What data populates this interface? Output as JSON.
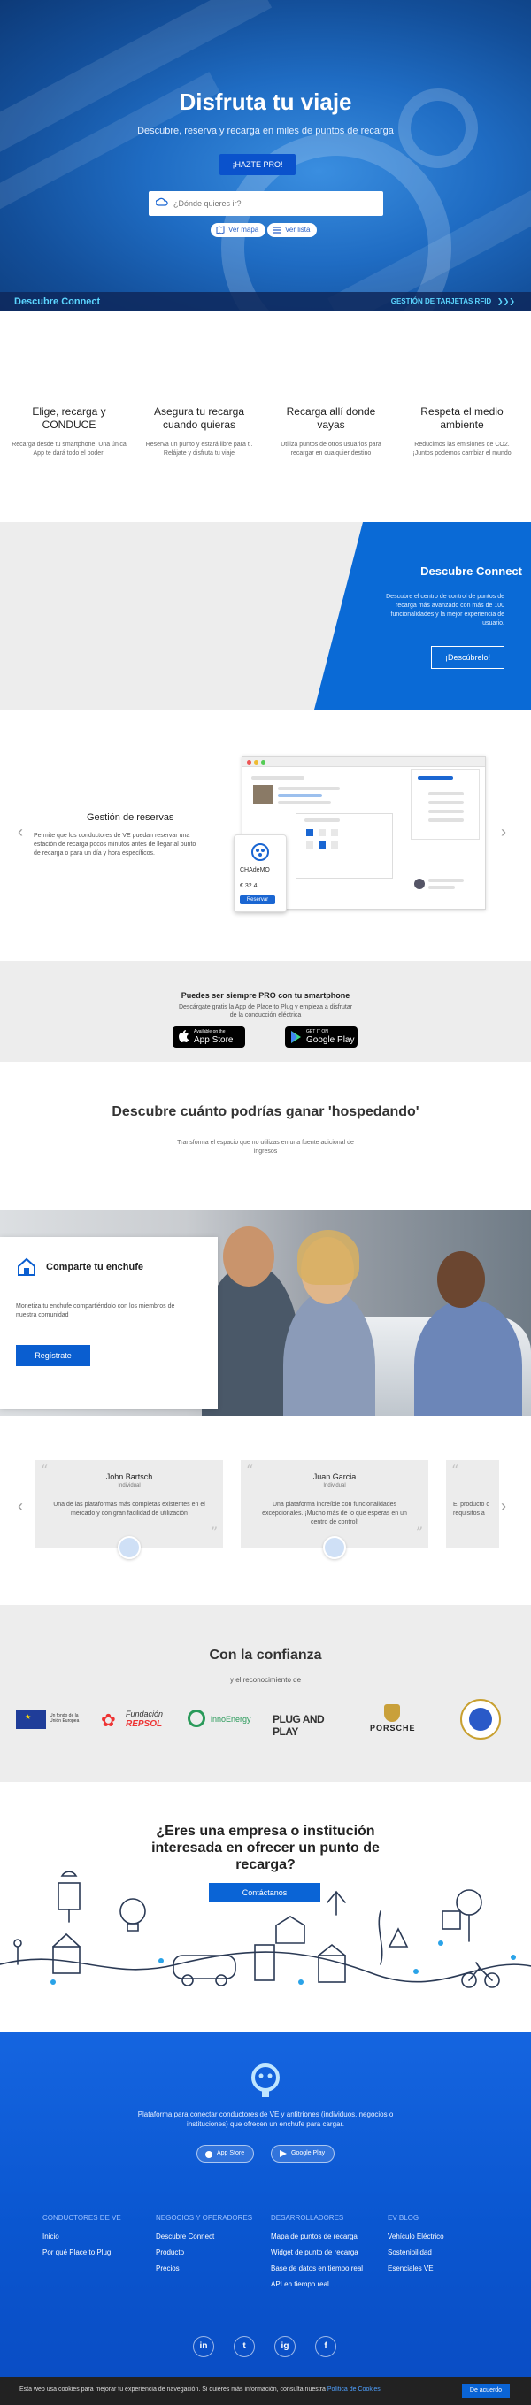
{
  "hero": {
    "title": "Disfruta tu viaje",
    "subtitle": "Descubre, reserva y recarga en miles de puntos de recarga",
    "pro_button": "¡HAZTE PRO!",
    "search_placeholder": "¿Dónde quieres ir?",
    "chip_map": "Ver mapa",
    "chip_list": "Ver lista",
    "bar_left": "Descubre Connect",
    "bar_right": "GESTIÓN DE TARJETAS RFID",
    "bar_arrows": "❯❯❯"
  },
  "features": [
    {
      "title": "Elige, recarga y CONDUCE",
      "text": "Recarga desde tu smartphone. Una única App te dará todo el poder!"
    },
    {
      "title": "Asegura tu recarga cuando quieras",
      "text": "Reserva un punto y estará libre para ti. Relájate y disfruta tu viaje"
    },
    {
      "title": "Recarga allí donde vayas",
      "text": "Utiliza puntos de otros usuarios para recargar en cualquier destino"
    },
    {
      "title": "Respeta el medio ambiente",
      "text": "Reducimos las emisiones de CO2. ¡Juntos podemos cambiar el mundo"
    }
  ],
  "connect": {
    "title": "Descubre Connect",
    "text": "Descubre el centro de control de puntos de recarga más avanzado con más de 100 funcionalidades y la mejor experiencia de usuario.",
    "button": "¡Descúbrelo!"
  },
  "reservas": {
    "title": "Gestión de reservas",
    "text": "Permite que los conductores de VE puedan reservar una estación de recarga pocos minutos antes de llegar al punto de recarga o para un día y hora específicos.",
    "phone_title": "CHAdeMO",
    "phone_price": "€ 32.4",
    "phone_button": "Reservar"
  },
  "apps": {
    "title": "Puedes ser siempre PRO con tu smartphone",
    "text": "Descárgate gratis la App de Place to Plug y empieza a disfrutar de la conducción eléctrica",
    "appstore_small": "Available on the",
    "appstore_big": "App Store",
    "google_small": "GET IT ON",
    "google_big": "Google Play"
  },
  "host": {
    "title": "Descubre cuánto podrías ganar 'hospedando'",
    "subtitle": "Transforma el espacio que no utilizas en una fuente adicional de ingresos"
  },
  "share": {
    "title": "Comparte tu enchufe",
    "text": "Monetiza tu enchufe compartiéndolo con los miembros de nuestra comunidad",
    "button": "Regístrate"
  },
  "testimonials": [
    {
      "name": "John Bartsch",
      "role": "Individual",
      "text": "Una de las plataformas más completas existentes en el mercado y con gran facilidad de utilización"
    },
    {
      "name": "Juan Garcia",
      "role": "Individual",
      "text": "Una plataforma increíble con funcionalidades excepcionales. ¡Mucho más de lo que esperas en un centro de control!"
    },
    {
      "name": "",
      "role": "",
      "text": "El producto c requisitos a"
    }
  ],
  "trust": {
    "title": "Con la confianza",
    "subtitle": "y el reconocimiento de",
    "logos": [
      "Unión Europea",
      "Fundación REPSOL",
      "Innoenergy",
      "PLUGANDPLAY",
      "PORSCHE",
      "Seal"
    ],
    "logo_texts": {
      "eu": "Un fondo de la Unión Europea",
      "repsol_1": "Fundación",
      "repsol_2": "REPSOL",
      "innoenergy": "innoEnergy",
      "plug": "PLUG AND PLAY",
      "porsche": "PORSCHE"
    }
  },
  "business": {
    "title": "¿Eres una empresa o institución interesada en ofrecer un punto de recarga?",
    "button": "Contáctanos"
  },
  "footer": {
    "tagline": "Plataforma para conectar conductores de VE y anfitriones (individuos, negocios o instituciones) que ofrecen un enchufe para cargar.",
    "appstore": "App Store",
    "googleplay": "Google Play",
    "columns": [
      {
        "heading": "CONDUCTORES DE VE",
        "items": [
          "Inicio",
          "Por qué Place to Plug"
        ]
      },
      {
        "heading": "NEGOCIOS Y OPERADORES",
        "items": [
          "Descubre Connect",
          "Producto",
          "Precios"
        ]
      },
      {
        "heading": "DESARROLLADORES",
        "items": [
          "Mapa de puntos de recarga",
          "Widget de punto de recarga",
          "Base de datos en tiempo real",
          "API en tiempo real"
        ]
      },
      {
        "heading": "EV BLOG",
        "items": [
          "Vehículo Eléctrico",
          "Sostenibilidad",
          "Esenciales VE"
        ]
      }
    ],
    "social": [
      "in",
      "t",
      "ig",
      "f"
    ]
  },
  "cookie": {
    "text": "Esta web usa cookies para mejorar tu experiencia de navegación. Si quieres más información, consulta nuestra ",
    "link": "Política de Cookies",
    "button": "De acuerdo"
  },
  "colors": {
    "primary": "#0a64d6",
    "hero": "#1f6cc3",
    "accent": "#5cd6ff",
    "footer": "#0a56d0"
  }
}
